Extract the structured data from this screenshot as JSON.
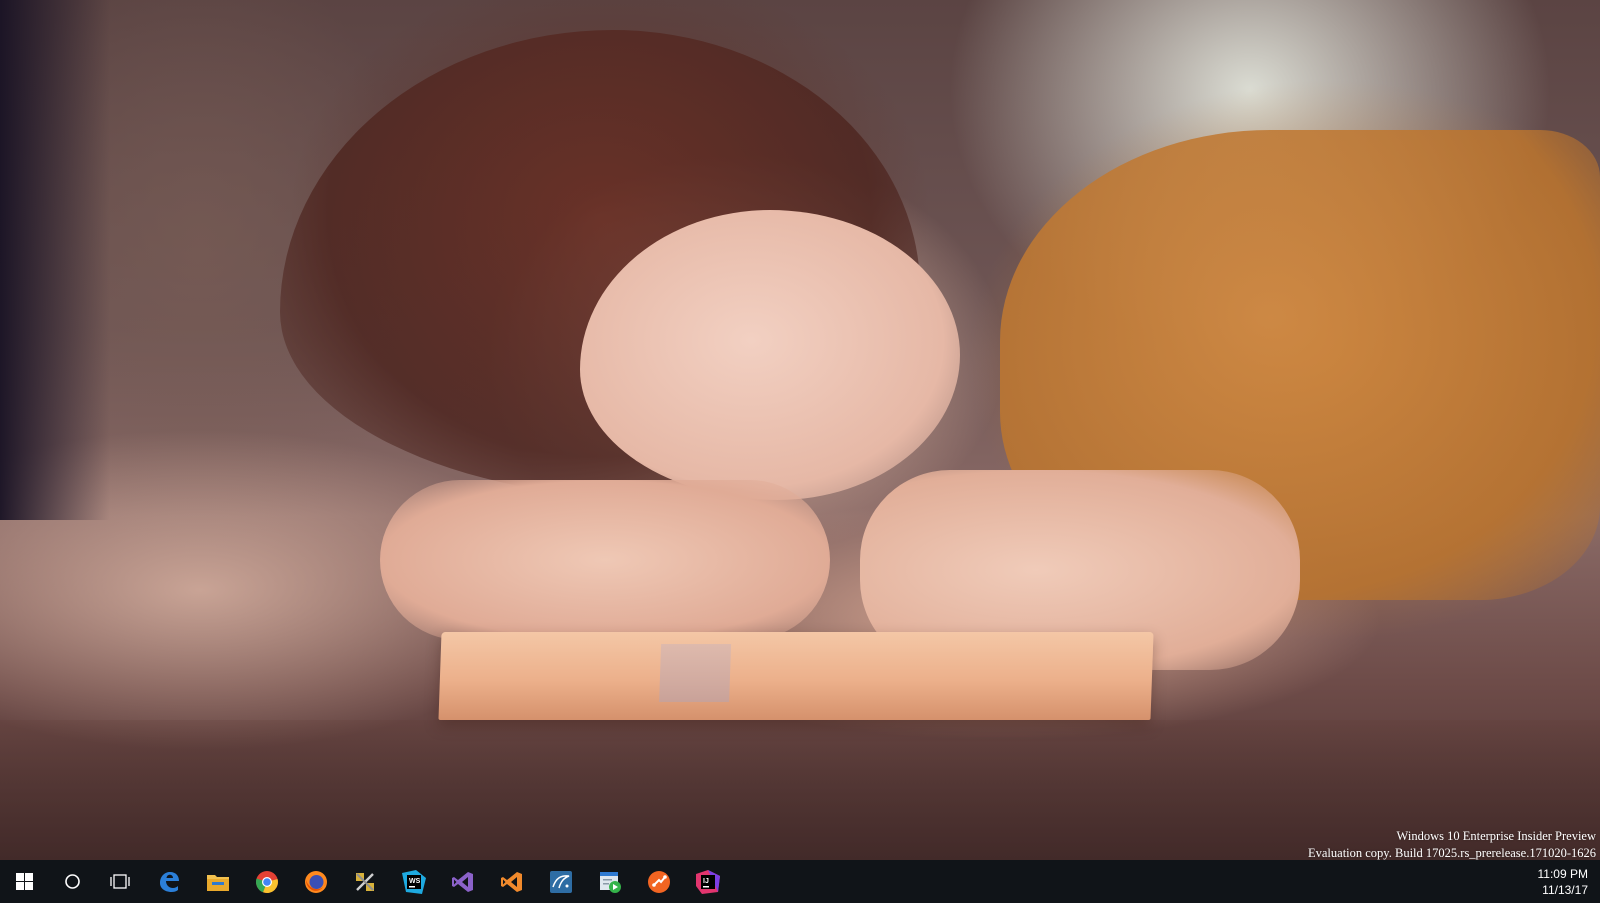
{
  "watermark": {
    "line1": "Windows 10 Enterprise Insider Preview",
    "line2": "Evaluation copy. Build 17025.rs_prerelease.171020-1626"
  },
  "taskbar": {
    "background": "#101418",
    "start_icon": "windows-logo-icon",
    "search_icon": "cortana-circle-icon",
    "taskview_icon": "task-view-icon",
    "pinned_apps": [
      {
        "name": "edge",
        "icon": "edge-icon",
        "color": "#2b7fd8"
      },
      {
        "name": "file-explorer",
        "icon": "folder-icon",
        "color": "#f2c14e"
      },
      {
        "name": "chrome",
        "icon": "chrome-icon",
        "color": "#e44134"
      },
      {
        "name": "firefox",
        "icon": "firefox-icon",
        "color": "#ff8a1f"
      },
      {
        "name": "tools",
        "icon": "tools-icon",
        "color": "#d8b23a"
      },
      {
        "name": "webstorm",
        "icon": "webstorm-icon",
        "color": "#1eaae0",
        "glyph": "WS"
      },
      {
        "name": "visual-studio",
        "icon": "visual-studio-icon",
        "color": "#8b62c9"
      },
      {
        "name": "visual-studio-code",
        "icon": "vs-code-icon",
        "color": "#f18a2c"
      },
      {
        "name": "mysql-workbench",
        "icon": "mysql-workbench-icon",
        "color": "#2e6da4"
      },
      {
        "name": "media-app",
        "icon": "media-player-icon",
        "color": "#34b34a"
      },
      {
        "name": "app-orange",
        "icon": "orange-app-icon",
        "color": "#f26522"
      },
      {
        "name": "intellij-idea",
        "icon": "intellij-icon",
        "color": "#e2356e",
        "glyph": "IJ"
      }
    ]
  },
  "clock": {
    "time": "11:09 PM",
    "date": "11/13/17"
  }
}
